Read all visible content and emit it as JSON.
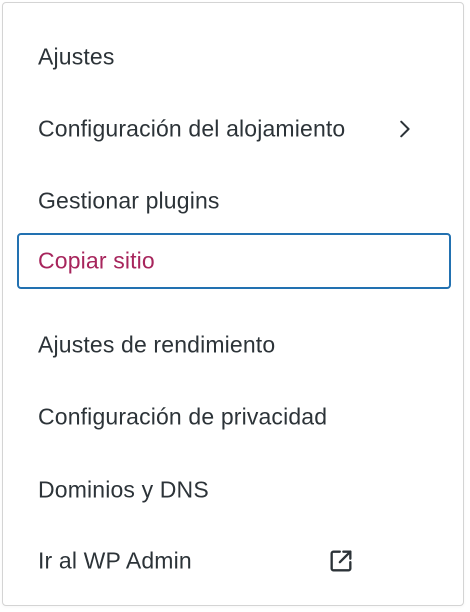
{
  "menu": {
    "items": [
      {
        "label": "Ajustes"
      },
      {
        "label": "Configuración del alojamiento",
        "icon": "chevron-right-icon"
      },
      {
        "label": "Gestionar plugins"
      },
      {
        "label": "Copiar sitio"
      },
      {
        "label": "Ajustes de rendimiento"
      },
      {
        "label": "Configuración de privacidad"
      },
      {
        "label": "Dominios y DNS"
      },
      {
        "label": "Ir al WP Admin",
        "icon": "external-link-icon"
      }
    ]
  },
  "colors": {
    "text": "#2c3338",
    "focus_border": "#2271b1",
    "focused_text": "#a7255c",
    "border": "#d4d4d4"
  }
}
